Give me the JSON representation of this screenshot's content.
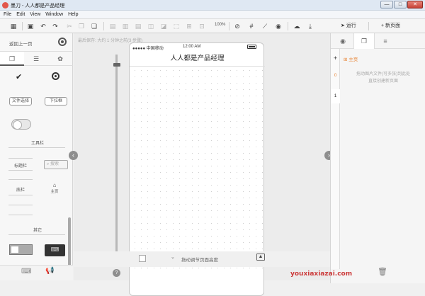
{
  "window": {
    "title": "墨刀 - 人人都是产品经理",
    "min": "—",
    "max": "□",
    "close": "✕"
  },
  "menu": [
    "File",
    "Edit",
    "View",
    "Window",
    "Help"
  ],
  "toolbar": {
    "zoom": "100%",
    "run_label": "运行",
    "new_page_label": "新页面"
  },
  "left_panel": {
    "back_label": "返回上一页",
    "components": {
      "file_select": "文件选择",
      "dropdown": "下拉框",
      "toolbar_heading": "工具栏",
      "titlebar_label": "标题栏",
      "search_placeholder": "搜索",
      "navbar_label": "底栏",
      "home_label": "主页",
      "other_heading": "其它"
    }
  },
  "canvas": {
    "saved_text": "最后保存: 大约 1 分钟之前(3 步骤)",
    "status_carrier": "●●●●● 中国移动",
    "status_time": "12:00 AM",
    "page_title": "人人都是产品经理",
    "height_hint": "拖动调节页面高度"
  },
  "right_panel": {
    "page_name": "主页",
    "page_numbers": [
      "0",
      "1"
    ],
    "drop_hint_line1": "拖动图片文件(可多张)到此处",
    "drop_hint_line2": "直接创建新页面"
  },
  "watermark": "youxiaxiazai.com"
}
